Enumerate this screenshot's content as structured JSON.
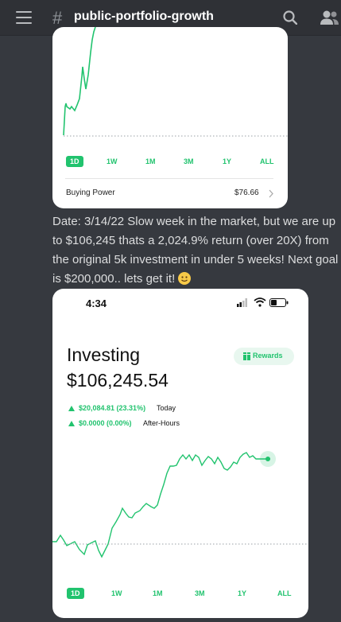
{
  "header": {
    "channel_name": "public-portfolio-growth",
    "hash": "#"
  },
  "icons": [
    "menu-icon",
    "search-icon",
    "members-icon",
    "signal-icon",
    "wifi-icon",
    "battery-icon",
    "rewards-icon",
    "chevron-right-icon",
    "smile-emoji-icon"
  ],
  "card1": {
    "periods": [
      "1D",
      "1W",
      "1M",
      "3M",
      "1Y",
      "ALL"
    ],
    "active_period": "1D",
    "buying_power_label": "Buying Power",
    "buying_power_value": "$76.66"
  },
  "message": {
    "text": "Date: 3/14/22  Slow week in the market, but we are up to $106,245 thats a 2,024.9% return (over 20X) from the original 5k investment in under 5 weeks! Next goal is $200,000.. lets get it!"
  },
  "card2": {
    "time": "4:34",
    "title": "Investing",
    "value": "$106,245.54",
    "rewards_label": "Rewards",
    "today_change": "$20,084.81 (23.31%)",
    "today_label": "Today",
    "after_change": "$0.0000 (0.00%)",
    "after_label": "After-Hours",
    "periods": [
      "1D",
      "1W",
      "1M",
      "3M",
      "1Y",
      "ALL"
    ],
    "active_period": "1D"
  },
  "colors": {
    "accent_green": "#21c36e",
    "background": "#36393f",
    "topbar": "#2f3136"
  }
}
